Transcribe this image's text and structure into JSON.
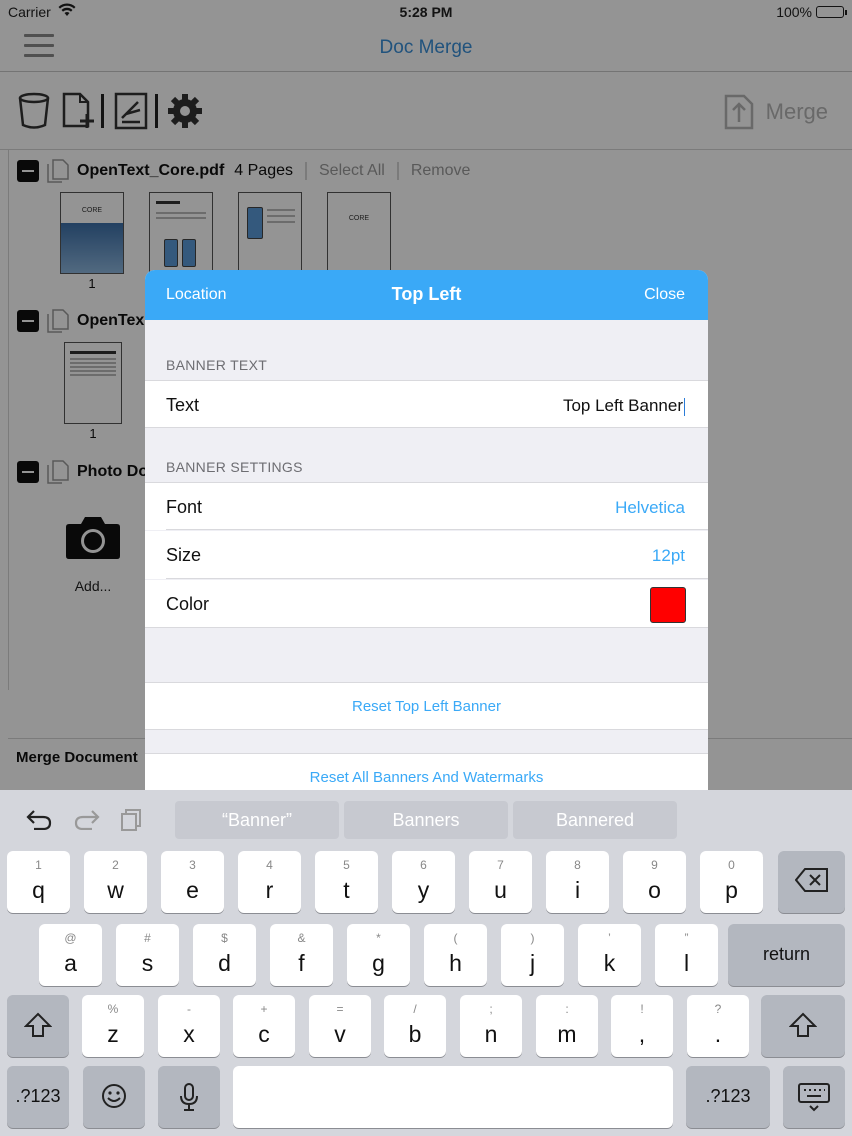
{
  "status": {
    "carrier": "Carrier",
    "time": "5:28 PM",
    "battery": "100%"
  },
  "nav": {
    "title": "Doc Merge"
  },
  "toolbar": {
    "merge_label": "Merge"
  },
  "documents": [
    {
      "name": "OpenText_Core.pdf",
      "pages": "4 Pages",
      "select_all": "Select All",
      "remove": "Remove",
      "thumbs": [
        "1"
      ],
      "cover_text": "CORE"
    },
    {
      "name": "OpenTex",
      "thumbs": [
        "1"
      ]
    },
    {
      "name": "Photo Do",
      "add_label": "Add..."
    }
  ],
  "merge_documents_label": "Merge Document",
  "modal": {
    "left": "Location",
    "title": "Top Left",
    "right": "Close",
    "banner_text_section": "BANNER TEXT",
    "text_label": "Text",
    "text_value": "Top Left Banner",
    "banner_settings_section": "BANNER SETTINGS",
    "font_label": "Font",
    "font_value": "Helvetica",
    "size_label": "Size",
    "size_value": "12pt",
    "color_label": "Color",
    "color_value": "#ff0000",
    "reset_label": "Reset Top Left Banner",
    "reset_all_label": "Reset All Banners And Watermarks"
  },
  "keyboard": {
    "suggestions": [
      "“Banner”",
      "Banners",
      "Bannered"
    ],
    "row1": [
      {
        "alt": "1",
        "main": "q"
      },
      {
        "alt": "2",
        "main": "w"
      },
      {
        "alt": "3",
        "main": "e"
      },
      {
        "alt": "4",
        "main": "r"
      },
      {
        "alt": "5",
        "main": "t"
      },
      {
        "alt": "6",
        "main": "y"
      },
      {
        "alt": "7",
        "main": "u"
      },
      {
        "alt": "8",
        "main": "i"
      },
      {
        "alt": "9",
        "main": "o"
      },
      {
        "alt": "0",
        "main": "p"
      }
    ],
    "row2": [
      {
        "alt": "@",
        "main": "a"
      },
      {
        "alt": "#",
        "main": "s"
      },
      {
        "alt": "$",
        "main": "d"
      },
      {
        "alt": "&",
        "main": "f"
      },
      {
        "alt": "*",
        "main": "g"
      },
      {
        "alt": "(",
        "main": "h"
      },
      {
        "alt": ")",
        "main": "j"
      },
      {
        "alt": "’",
        "main": "k"
      },
      {
        "alt": "”",
        "main": "l"
      }
    ],
    "row3": [
      {
        "alt": "%",
        "main": "z"
      },
      {
        "alt": "-",
        "main": "x"
      },
      {
        "alt": "+",
        "main": "c"
      },
      {
        "alt": "=",
        "main": "v"
      },
      {
        "alt": "/",
        "main": "b"
      },
      {
        "alt": ";",
        "main": "n"
      },
      {
        "alt": ":",
        "main": "m"
      },
      {
        "alt": "!",
        "main": ","
      },
      {
        "alt": "?",
        "main": "."
      }
    ],
    "return_label": "return",
    "numbers_label": ".?123"
  }
}
